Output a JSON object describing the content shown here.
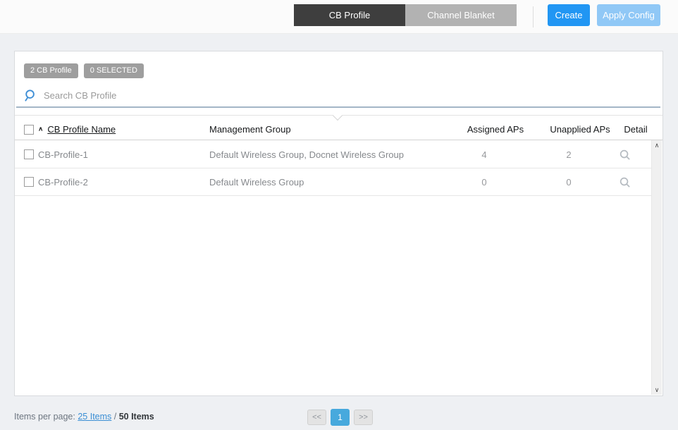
{
  "colors": {
    "accent_blue": "#2196f3",
    "disabled_blue": "#90c8f6",
    "active_tab_bg": "#3e3e3e",
    "inactive_tab_bg": "#b2b2b2",
    "badge_bg": "#9e9e9e",
    "search_underline": "#a4b6c7",
    "current_page_bg": "#47a9dd",
    "page_bg": "#eef0f3"
  },
  "topbar": {
    "tabs": [
      {
        "label": "CB Profile",
        "active": true
      },
      {
        "label": "Channel Blanket",
        "active": false
      }
    ],
    "create_label": "Create",
    "apply_config_label": "Apply Config"
  },
  "panel": {
    "badges": [
      {
        "label": "2 CB Profile"
      },
      {
        "label": "0 SELECTED"
      }
    ],
    "search": {
      "placeholder": "Search CB Profile",
      "value": ""
    }
  },
  "table": {
    "sort_indicator": "∧",
    "headers": {
      "name": "CB Profile Name",
      "management_group": "Management Group",
      "assigned_aps": "Assigned APs",
      "unapplied_aps": "Unapplied APs",
      "detail": "Detail"
    },
    "rows": [
      {
        "name": "CB-Profile-1",
        "management_group": "Default Wireless Group, Docnet Wireless Group",
        "assigned_aps": "4",
        "unapplied_aps": "2"
      },
      {
        "name": "CB-Profile-2",
        "management_group": "Default Wireless Group",
        "assigned_aps": "0",
        "unapplied_aps": "0"
      }
    ]
  },
  "scrollbar": {
    "up_glyph": "∧",
    "down_glyph": "∨"
  },
  "footer": {
    "items_per_page_label": "Items per page:",
    "page_size_link": "25 Items",
    "separator": " / ",
    "total_label": "50 Items",
    "pagination": {
      "prev": "<<",
      "current": "1",
      "next": ">>"
    }
  }
}
